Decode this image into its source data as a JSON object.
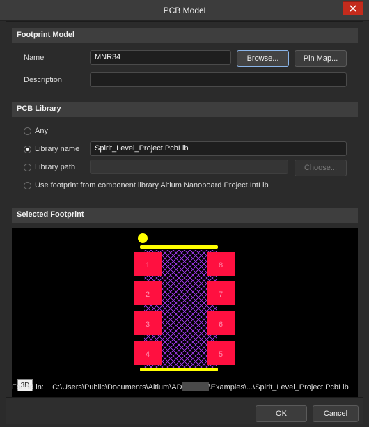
{
  "window": {
    "title": "PCB Model"
  },
  "footprint_model": {
    "header": "Footprint Model",
    "name_label": "Name",
    "name_value": "MNR34",
    "description_label": "Description",
    "description_value": "",
    "browse_label": "Browse...",
    "pin_map_label": "Pin Map..."
  },
  "pcb_library": {
    "header": "PCB Library",
    "options": [
      {
        "label": "Any",
        "checked": false
      },
      {
        "label": "Library name",
        "checked": true
      },
      {
        "label": "Library path",
        "checked": false
      },
      {
        "label": "Use footprint from component library Altium Nanoboard Project.IntLib",
        "checked": false
      }
    ],
    "library_name_value": "Spirit_Level_Project.PcbLib",
    "library_path_value": "",
    "choose_label": "Choose..."
  },
  "selected_footprint": {
    "header": "Selected Footprint",
    "view_3d_label": "3D",
    "pads_left": [
      "1",
      "2",
      "3",
      "4"
    ],
    "pads_right": [
      "8",
      "7",
      "6",
      "5"
    ],
    "found_in_label": "Found in:",
    "found_in_path_start": "C:\\Users\\Public\\Documents\\Altium\\AD",
    "found_in_path_end": "\\Examples\\...\\Spirit_Level_Project.PcbLib"
  },
  "buttons": {
    "ok": "OK",
    "cancel": "Cancel"
  },
  "colors": {
    "pad": "#ff1040",
    "silkscreen": "#ffff00",
    "body_hatch": "#b040ff",
    "pad_text": "#ff90b0"
  }
}
